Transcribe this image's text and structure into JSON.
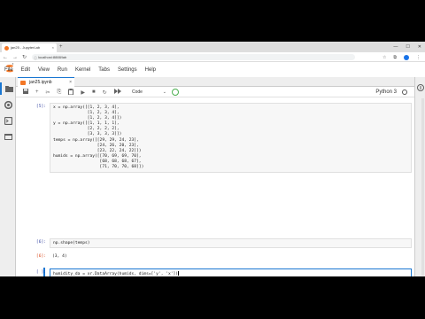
{
  "browser": {
    "tab_title": "jan25 - JupyterLab",
    "new_tab": "+",
    "win_min": "—",
    "win_max": "☐",
    "win_close": "✕",
    "tab_close": "×",
    "url": "localhost:8888/lab",
    "nav_back": "←",
    "nav_forward": "→",
    "nav_reload": "↻"
  },
  "menu": [
    "File",
    "Edit",
    "View",
    "Run",
    "Kernel",
    "Tabs",
    "Settings",
    "Help"
  ],
  "notebook_tab": {
    "title": "jan25.ipynb",
    "close": "×"
  },
  "toolbar": {
    "save": "💾",
    "add": "+",
    "cut": "✂",
    "copy": "⎘",
    "paste": "📋",
    "run": "▶",
    "stop": "■",
    "restart": "↻",
    "fast_forward": "⏩",
    "cell_type": "Code",
    "kernel": "Python 3"
  },
  "cells": [
    {
      "prompt": "[5]:",
      "lines": [
        "x = np.array([[1, 2, 3, 4],",
        "              [1, 2, 3, 4],",
        "              [1, 2, 3, 4]])",
        "y = np.array([[1, 1, 1, 1],",
        "              [2, 2, 2, 2],",
        "              [3, 3, 3, 3]])",
        "temps = np.array([[29, 29, 24, 23],",
        "                  [24, 26, 20, 23],",
        "                  [23, 22, 24, 22]])",
        "humids = np.array([[70, 69, 69, 70],",
        "                   [68, 68, 68, 67],",
        "                   [71, 70, 70, 68]])"
      ]
    },
    {
      "prompt": "[6]:",
      "lines": [
        "np.shape(temps)"
      ],
      "out_prompt": "[6]:",
      "output": "(3, 4)"
    },
    {
      "prompt": "[ ]:",
      "lines": [
        "humidity_da = xr.DataArray(humids, dims=['y', 'x'])"
      ]
    }
  ]
}
